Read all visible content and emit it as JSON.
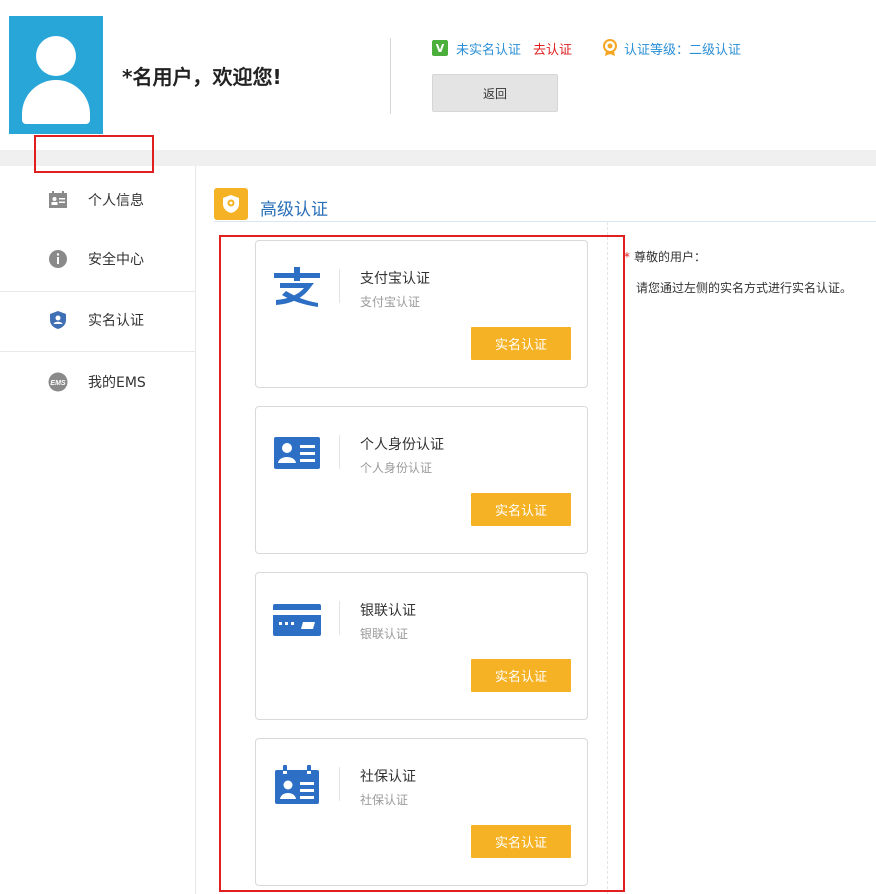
{
  "header": {
    "welcome": "*名用户，欢迎您!",
    "status_badge": "V",
    "status_text": "未实名认证",
    "go_link": "去认证",
    "level_text": "认证等级：二级认证",
    "back_label": "返回"
  },
  "sidebar": {
    "items": [
      {
        "label": "个人信息"
      },
      {
        "label": "安全中心"
      },
      {
        "label": "实名认证"
      },
      {
        "label": "我的EMS"
      }
    ]
  },
  "section": {
    "title": "高级认证"
  },
  "cards": [
    {
      "title": "支付宝认证",
      "subtitle": "支付宝认证",
      "button": "实名认证"
    },
    {
      "title": "个人身份认证",
      "subtitle": "个人身份认证",
      "button": "实名认证"
    },
    {
      "title": "银联认证",
      "subtitle": "银联认证",
      "button": "实名认证"
    },
    {
      "title": "社保认证",
      "subtitle": "社保认证",
      "button": "实名认证"
    }
  ],
  "notice": {
    "star": "*",
    "heading": "尊敬的用户：",
    "body": "请您通过左侧的实名方式进行实名认证。"
  },
  "colors": {
    "accent_blue": "#2a8fd6",
    "button_yellow": "#f5b224",
    "alert_red": "#e02020",
    "avatar_blue": "#29a6d8"
  },
  "icons": [
    "user-avatar-icon",
    "verified-v-icon",
    "medal-icon",
    "id-card-icon",
    "info-icon",
    "shield-icon",
    "ems-icon",
    "alipay-icon",
    "identity-card-icon",
    "bank-card-icon",
    "social-security-icon"
  ]
}
